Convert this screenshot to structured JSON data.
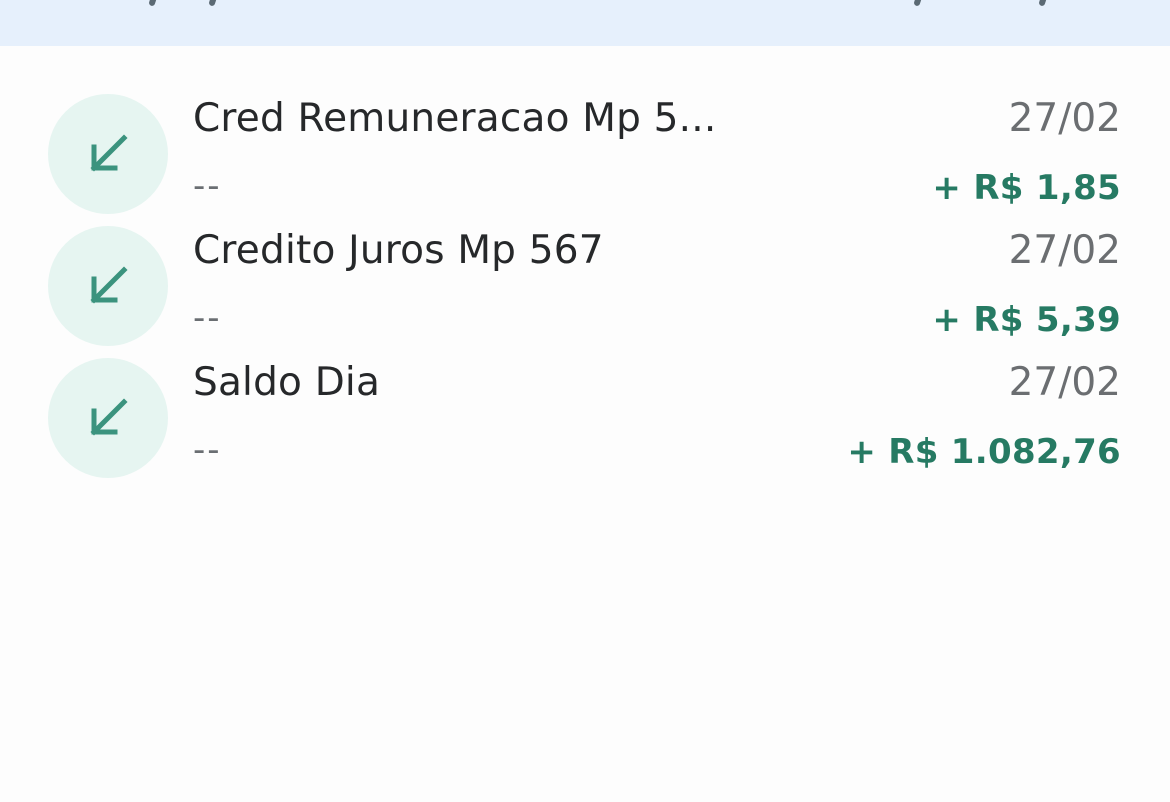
{
  "colors": {
    "banner_bg": "#e6f0fc",
    "icon_bg": "#e6f5f1",
    "icon_fg": "#3b937e",
    "amount_green": "#267a63",
    "title_text": "#26282a",
    "muted_text": "#6b6e71"
  },
  "transactions": [
    {
      "icon": "arrow-down-left-icon",
      "title": "Cred Remuneracao Mp 5...",
      "subtitle": "--",
      "date": "27/02",
      "amount": "+ R$ 1,85"
    },
    {
      "icon": "arrow-down-left-icon",
      "title": "Credito Juros Mp 567",
      "subtitle": "--",
      "date": "27/02",
      "amount": "+ R$ 5,39"
    },
    {
      "icon": "arrow-down-left-icon",
      "title": "Saldo Dia",
      "subtitle": "--",
      "date": "27/02",
      "amount": "+ R$ 1.082,76"
    }
  ]
}
